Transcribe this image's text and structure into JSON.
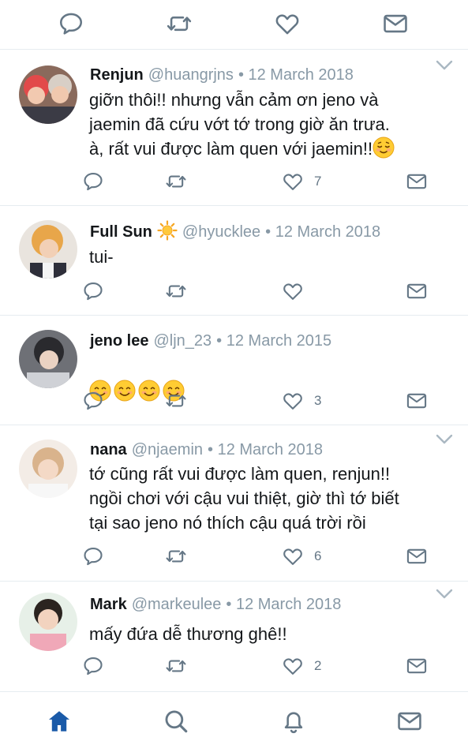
{
  "colors": {
    "icon": "#657786",
    "accent": "#1a5aa8",
    "meta": "#8899a6",
    "divider": "#e6ecf0"
  },
  "top_bar": {
    "icons": [
      "reply-icon",
      "retweet-icon",
      "like-icon",
      "message-icon"
    ]
  },
  "tweets": [
    {
      "name": "Renjun",
      "handle": "@huangrjns",
      "date": "• 12 March 2018",
      "lines": [
        "giỡn thôi!! nhưng vẫn cảm ơn jeno và",
        "jaemin đã cứu vớt tớ trong giờ ăn trưa.",
        "à, rất vui được làm quen với jaemin!!"
      ],
      "emoji_end": "relieved-face-emoji",
      "like_count": "7",
      "has_chevron": true
    },
    {
      "name": "Full Sun",
      "name_emoji": "sun-emoji",
      "handle": "@hyucklee",
      "date": "• 12 March 2018",
      "lines": [
        "tui-"
      ],
      "like_count": "",
      "has_chevron": false
    },
    {
      "name": "jeno lee",
      "handle": "@ljn_23",
      "date": "• 12 March 2015",
      "emojis": [
        "smiling-face-emoji",
        "smiling-face-emoji",
        "smiling-face-emoji",
        "smiling-face-emoji"
      ],
      "like_count": "3",
      "has_chevron": false
    },
    {
      "name": "nana",
      "handle": "@njaemin",
      "date": "• 12 March 2018",
      "lines": [
        "tớ cũng rất vui được làm quen, renjun!!",
        "ngồi chơi với cậu vui thiệt, giờ thì tớ biết",
        "tại sao jeno nó thích cậu quá trời rồi"
      ],
      "like_count": "6",
      "has_chevron": true
    },
    {
      "name": "Mark",
      "handle": "@markeulee",
      "date": "• 12 March 2018",
      "lines": [
        "mấy đứa dễ thương ghê!!"
      ],
      "like_count": "2",
      "has_chevron": true
    }
  ],
  "bottom_nav": {
    "items": [
      "home-icon",
      "search-icon",
      "notifications-icon",
      "messages-icon"
    ],
    "active": "home-icon"
  }
}
